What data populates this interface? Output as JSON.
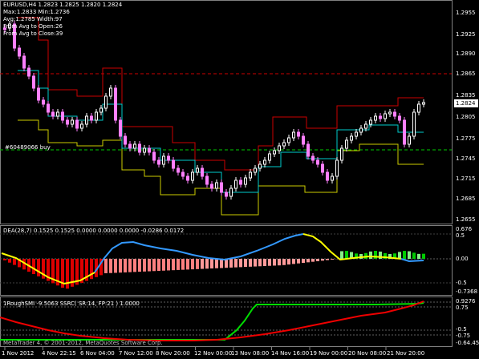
{
  "main_info": {
    "symbol_line": "EURUSD,H4  1.2823 1.2825 1.2820 1.2824",
    "max_min": "Max:1.2833 Min:1.2736",
    "avg_width": "Avg:1.2785 Width:97",
    "from_open": "From Avg to Open:26",
    "from_close": "From Avg to Close:39"
  },
  "trade_label": "#60489066 buy",
  "price_axis": [
    "1.2955",
    "1.2925",
    "1.2890",
    "1.2865",
    "1.2835",
    "1.2805",
    "1.2775",
    "1.2745",
    "1.2715",
    "1.2685",
    "1.2655"
  ],
  "current_price": "1.2824",
  "dea_panel": {
    "title": "DEA(28,7) 0.1525 0.1525 0.0000 0.0000 0.0000 -0.0286 0.0172",
    "axis": [
      "0.676",
      "0.5",
      "0.00",
      "-0.5",
      "-0.7368"
    ]
  },
  "rough_panel": {
    "title": "1RoughSMI -9.5063 SSRC( SR:14, FP:21 ) 1.0000",
    "axis": [
      "0.9276",
      "0.75",
      "-0.5",
      "-0.75",
      "-0.64.458"
    ]
  },
  "watermark": "MetaTrader 4, © 2001-2012, MetaQuotes Software Corp.",
  "time_axis": [
    "1 Nov 2012",
    "4 Nov 22:15",
    "6 Nov 04:00",
    "7 Nov 12:00",
    "8 Nov 20:00",
    "12 Nov 00:00",
    "13 Nov 08:00",
    "14 Nov 16:00",
    "19 Nov 00:00",
    "20 Nov 08:00",
    "21 Nov 20:00"
  ],
  "colors": {
    "background": "#000000",
    "bull": "#ff80ff",
    "bear": "#ffffff",
    "upper_band": "#cc0000",
    "lower_band": "#cccc00",
    "mid_line": "#00cccc",
    "entry_line": "#00cc00",
    "hline_red": "#cc0000",
    "hist_neg": "#e00000",
    "hist_pos": "#00cc00",
    "dea_signal_pos": "#3399ff",
    "dea_signal_neg": "#ffff00",
    "rough_green": "#00dd00",
    "rough_red": "#ee0000"
  }
}
